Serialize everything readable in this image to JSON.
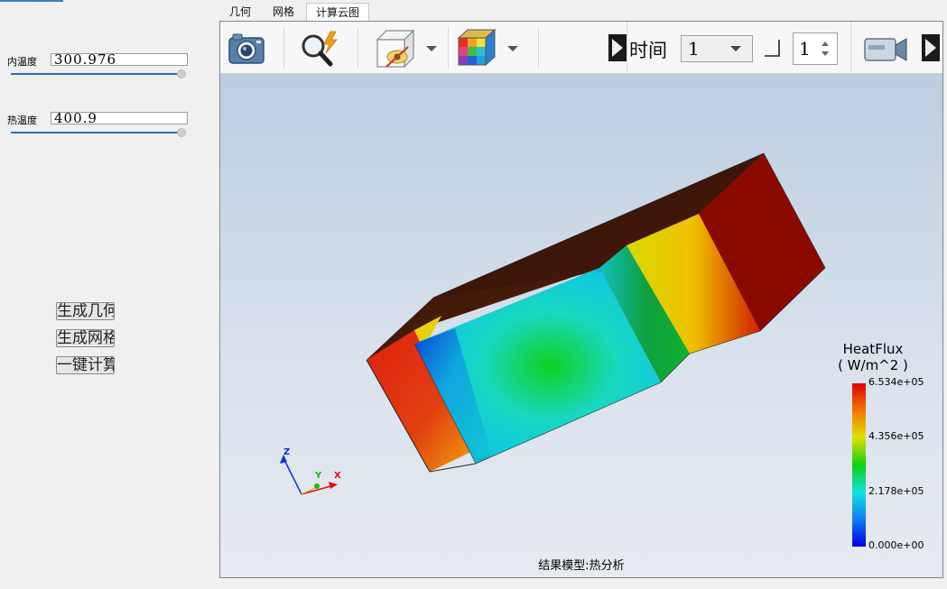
{
  "params": {
    "inner_temp": {
      "label": "内温度",
      "value": "300.976",
      "slider_fraction": 1.0
    },
    "hot_temp": {
      "label": "热温度",
      "value": "400.9",
      "slider_fraction": 1.0
    }
  },
  "buttons": {
    "gen_geometry": "生成几何",
    "gen_mesh": "生成网格",
    "one_click_compute": "一键计算"
  },
  "tabs": [
    {
      "label": "几何",
      "active": false
    },
    {
      "label": "网格",
      "active": false
    },
    {
      "label": "计算云图",
      "active": true
    }
  ],
  "toolbar": {
    "time_label": "时间",
    "time_value": "1",
    "step_value": "1",
    "icons": [
      "camera-icon",
      "search-flash-icon",
      "box-visibility-icon",
      "color-cube-icon",
      "video-camera-icon"
    ]
  },
  "legend": {
    "title_line1": "HeatFlux",
    "title_line2": "( W/m^2 )",
    "ticks": [
      "6.534e+05",
      "4.356e+05",
      "2.178e+05",
      "0.000e+00"
    ],
    "max": 653400,
    "min": 0
  },
  "axes": {
    "x": "X",
    "y": "Y",
    "z": "Z",
    "x_color": "#e01010",
    "y_color": "#10c010",
    "z_color": "#1030d0"
  },
  "caption": "结果模型:热分析",
  "colors": {
    "accent": "#2b6cb8"
  }
}
